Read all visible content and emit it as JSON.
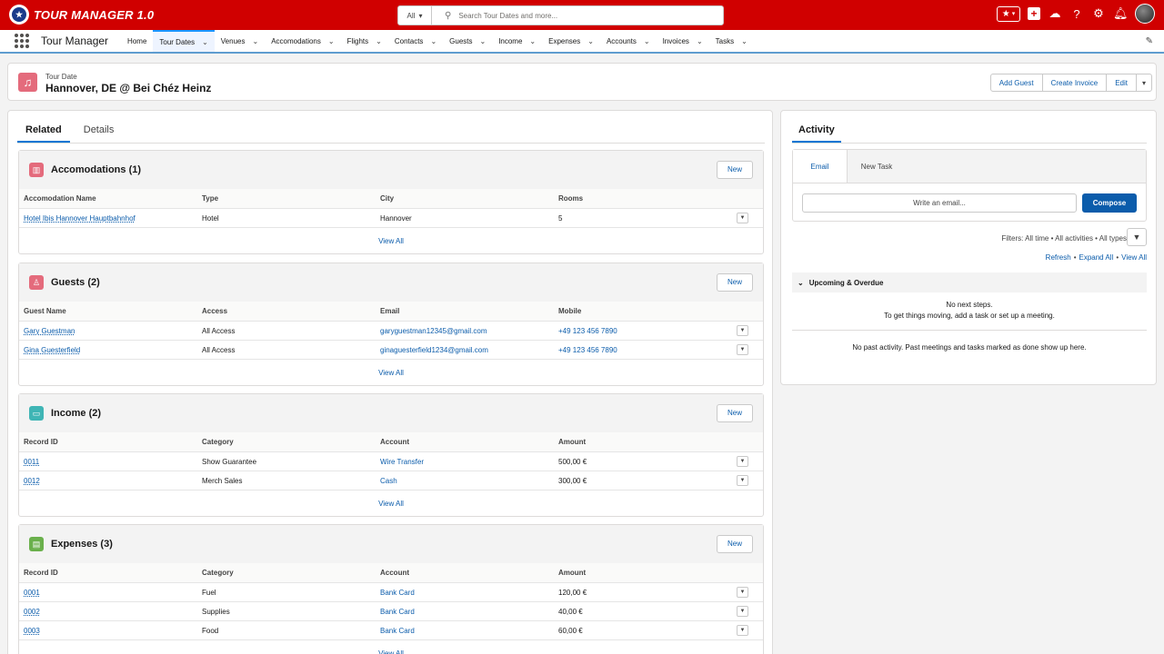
{
  "header": {
    "app_logo_text": "TOUR MANAGER 1.0",
    "search_scope": "All",
    "search_placeholder": "Search Tour Dates and more..."
  },
  "nav": {
    "app_name": "Tour Manager",
    "items": [
      {
        "label": "Home",
        "dropdown": false
      },
      {
        "label": "Tour Dates",
        "dropdown": true,
        "active": true
      },
      {
        "label": "Venues",
        "dropdown": true
      },
      {
        "label": "Accomodations",
        "dropdown": true
      },
      {
        "label": "Flights",
        "dropdown": true
      },
      {
        "label": "Contacts",
        "dropdown": true
      },
      {
        "label": "Guests",
        "dropdown": true
      },
      {
        "label": "Income",
        "dropdown": true
      },
      {
        "label": "Expenses",
        "dropdown": true
      },
      {
        "label": "Accounts",
        "dropdown": true
      },
      {
        "label": "Invoices",
        "dropdown": true
      },
      {
        "label": "Tasks",
        "dropdown": true
      }
    ]
  },
  "record": {
    "type": "Tour Date",
    "title": "Hannover, DE @ Bei Chéz Heinz",
    "actions": [
      "Add Guest",
      "Create Invoice",
      "Edit"
    ]
  },
  "tabs": [
    "Related",
    "Details"
  ],
  "accomodations": {
    "title": "Accomodations (1)",
    "new_label": "New",
    "columns": [
      "Accomodation Name",
      "Type",
      "City",
      "Rooms"
    ],
    "rows": [
      [
        "Hotel Ibis Hannover Hauptbahnhof",
        "Hotel",
        "Hannover",
        "5"
      ]
    ],
    "view_all": "View All"
  },
  "guests": {
    "title": "Guests (2)",
    "new_label": "New",
    "columns": [
      "Guest Name",
      "Access",
      "Email",
      "Mobile"
    ],
    "rows": [
      [
        "Gary Guestman",
        "All Access",
        "garyguestman12345@gmail.com",
        "+49 123 456 7890"
      ],
      [
        "Gina Guesterfield",
        "All Access",
        "ginaguesterfield1234@gmail.com",
        "+49 123 456 7890"
      ]
    ],
    "view_all": "View All"
  },
  "income": {
    "title": "Income (2)",
    "new_label": "New",
    "columns": [
      "Record ID",
      "Category",
      "Account",
      "Amount"
    ],
    "rows": [
      [
        "0011",
        "Show Guarantee",
        "Wire Transfer",
        "500,00 €"
      ],
      [
        "0012",
        "Merch Sales",
        "Cash",
        "300,00 €"
      ]
    ],
    "view_all": "View All"
  },
  "expenses": {
    "title": "Expenses (3)",
    "new_label": "New",
    "columns": [
      "Record ID",
      "Category",
      "Account",
      "Amount"
    ],
    "rows": [
      [
        "0001",
        "Fuel",
        "Bank Card",
        "120,00 €"
      ],
      [
        "0002",
        "Supplies",
        "Bank Card",
        "40,00 €"
      ],
      [
        "0003",
        "Food",
        "Bank Card",
        "60,00 €"
      ]
    ],
    "view_all": "View All"
  },
  "activity": {
    "tab": "Activity",
    "composer_tabs": [
      "Email",
      "New Task"
    ],
    "email_placeholder": "Write an email...",
    "compose_label": "Compose",
    "filters": "Filters: All time • All activities • All types",
    "links": [
      "Refresh",
      "Expand All",
      "View All"
    ],
    "upcoming_label": "Upcoming & Overdue",
    "no_steps_1": "No next steps.",
    "no_steps_2": "To get things moving, add a task or set up a meeting.",
    "no_past": "No past activity. Past meetings and tasks marked as done show up here."
  },
  "colors": {
    "header_red": "#d00000",
    "accom_icon": "#e46b7c",
    "guests_icon": "#e46b7c",
    "income_icon": "#3fb5b5",
    "expenses_icon": "#6ab04c",
    "link_blue": "#0b5cab"
  }
}
